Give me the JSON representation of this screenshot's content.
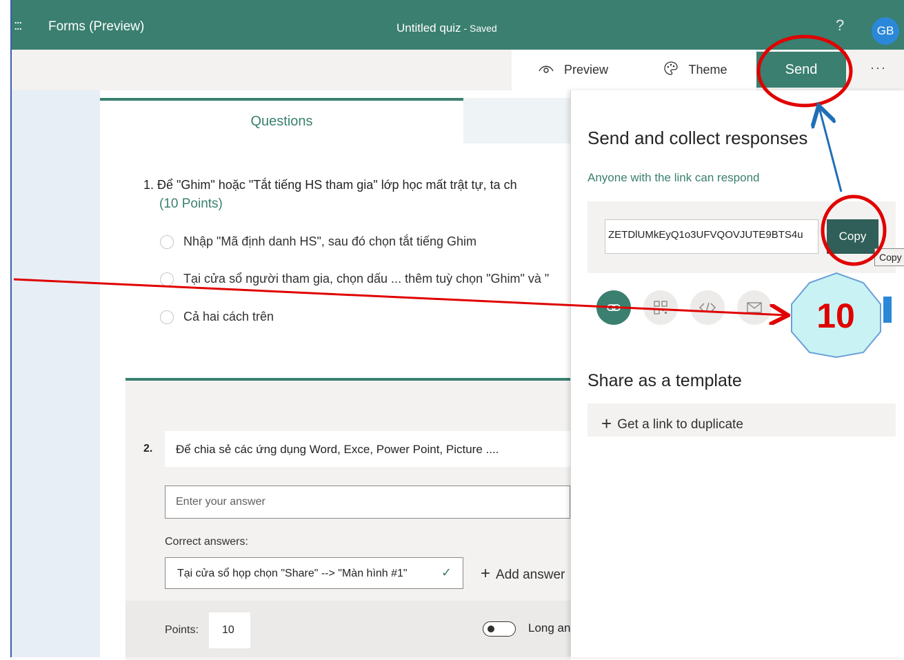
{
  "header": {
    "waffle": ":::",
    "app_name": "Forms (Preview)",
    "doc_title": "Untitled quiz",
    "doc_status": " - Saved",
    "help": "?",
    "avatar": "GB"
  },
  "toolbar": {
    "preview_label": "Preview",
    "theme_label": "Theme",
    "send_label": "Send",
    "more_label": "···"
  },
  "tabs": {
    "questions": "Questions"
  },
  "question1": {
    "text": "1. Để \"Ghim\" hoặc \"Tắt tiếng HS tham gia\" lớp học mất trật tự, ta ch",
    "points": "(10 Points)",
    "options": [
      "Nhập \"Mã định danh HS\", sau đó chọn tắt tiếng Ghim",
      "Tại cửa sổ người tham gia, chọn dấu ... thêm tuỳ chọn \"Ghim\" và \"",
      "Cả hai cách trên"
    ]
  },
  "question2": {
    "number": "2.",
    "text": "Để chia sẻ các ứng dụng Word, Exce, Power Point, Picture ....",
    "answer_placeholder": "Enter your answer",
    "correct_label": "Correct answers:",
    "correct_answer": "Tại cửa sổ họp chọn \"Share\" --> \"Màn hình #1\"",
    "add_answer": "Add answer",
    "points_label": "Points:",
    "points_value": "10",
    "long_answer": "Long an"
  },
  "send_panel": {
    "title": "Send and collect responses",
    "audience": "Anyone with the link can respond",
    "link": "ZETDlUMkEyQ1o3UFVQOVJUTE9BTS4u",
    "copy_label": "Copy",
    "copy_tooltip": "Copy",
    "share_icons": [
      "link-icon",
      "qr-code-icon",
      "embed-icon",
      "email-icon"
    ],
    "template_title": "Share as a template",
    "duplicate_label": "Get a link to duplicate"
  },
  "annotation": {
    "step_number": "10"
  },
  "colors": {
    "brand": "#3a7f6f",
    "annotation_red": "#e00000",
    "annotation_blue": "#1f6fb5",
    "badge_fill": "#c9f2f4"
  }
}
